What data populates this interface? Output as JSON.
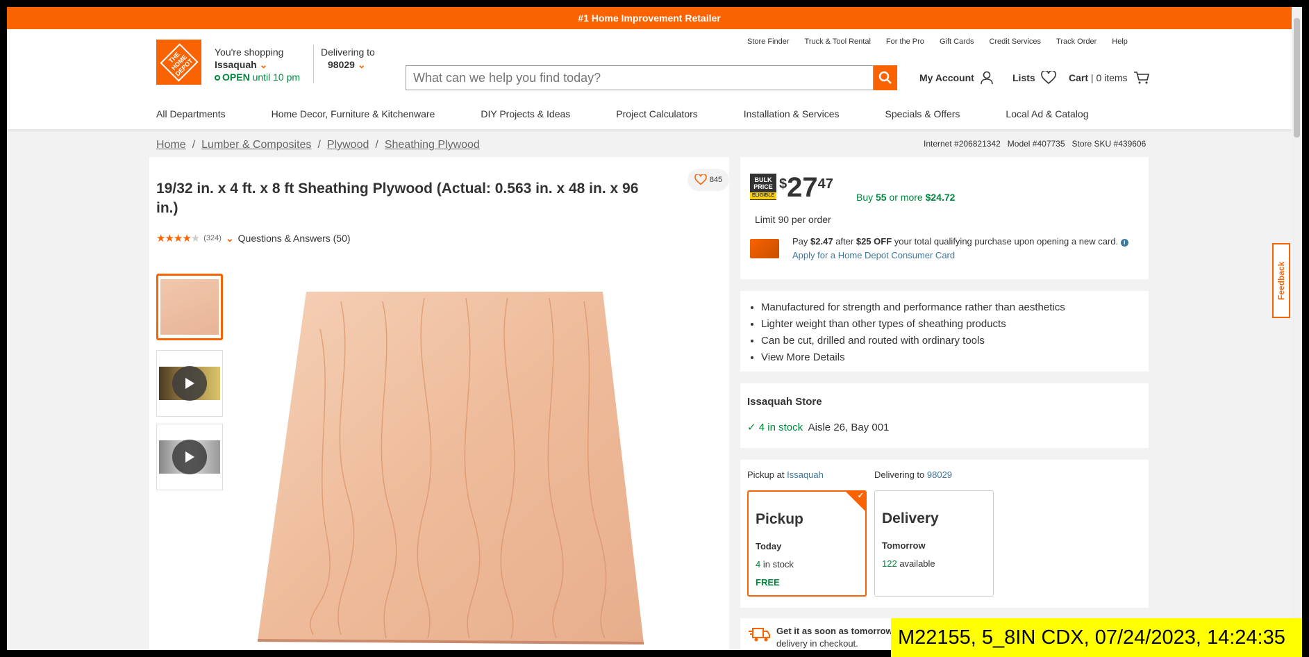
{
  "promo": "#1 Home Improvement Retailer",
  "logo": "THE HOME DEPOT",
  "store": {
    "shopping_label": "You're shopping",
    "name": "Issaquah",
    "open": "OPEN",
    "hours": "until 10 pm"
  },
  "delivery": {
    "label": "Delivering to",
    "zip": "98029"
  },
  "search": {
    "placeholder": "What can we help you find today?"
  },
  "toplinks": [
    "Store Finder",
    "Truck & Tool Rental",
    "For the Pro",
    "Gift Cards",
    "Credit Services",
    "Track Order",
    "Help"
  ],
  "account": {
    "my_account": "My Account",
    "lists": "Lists",
    "cart": "Cart",
    "cart_items": "0 items"
  },
  "nav": [
    "All Departments",
    "Home Decor, Furniture & Kitchenware",
    "DIY Projects & Ideas",
    "Project Calculators",
    "Installation & Services",
    "Specials & Offers",
    "Local Ad & Catalog"
  ],
  "breadcrumb": [
    "Home",
    "Lumber & Composites",
    "Plywood",
    "Sheathing Plywood"
  ],
  "ids": {
    "internet": "Internet #206821342",
    "model": "Model #407735",
    "sku": "Store SKU #439606"
  },
  "product": {
    "title": "19/32 in. x 4 ft. x 8 ft Sheathing Plywood (Actual: 0.563 in. x 48 in. x 96 in.)",
    "favorites": "845",
    "rating": 4,
    "reviews": "(324)",
    "qa": "Questions & Answers (50)"
  },
  "pricing": {
    "bulk": "BULK PRICE",
    "bulk_sub": "ELIGIBLE",
    "dollar": "$",
    "whole": "27",
    "cents": "47",
    "buy_prefix": "Buy",
    "buy_qty": "55",
    "buy_mid": "or more",
    "buy_price": "$24.72",
    "limit": "Limit 90 per order",
    "pay_text_1": "Pay",
    "pay_amt": "$2.47",
    "pay_text_2": "after",
    "pay_off": "$25 OFF",
    "pay_text_3": "your total qualifying purchase upon opening a new card.",
    "apply": "Apply for a Home Depot Consumer Card"
  },
  "bullets": [
    "Manufactured for strength and performance rather than aesthetics",
    "Lighter weight than other types of sheathing products",
    "Can be cut, drilled and routed with ordinary tools"
  ],
  "details_link": "View More Details",
  "store_stock": {
    "name": "Issaquah Store",
    "stock": "4 in stock",
    "location": "Aisle 26, Bay 001"
  },
  "fulfillment": {
    "pickup_label": "Pickup at",
    "pickup_store": "Issaquah",
    "deliv_label": "Delivering to",
    "deliv_zip": "98029",
    "pickup": {
      "title": "Pickup",
      "when": "Today",
      "qty": "4",
      "qty_text": "in stock",
      "price": "FREE"
    },
    "delivery": {
      "title": "Delivery",
      "when": "Tomorrow",
      "qty": "122",
      "qty_text": "available"
    }
  },
  "ship": {
    "line1": "Get it as soon as tomorrow",
    "line2": "delivery in checkout."
  },
  "feedback": "Feedback",
  "stamp": "M22155, 5_8IN CDX, 07/24/2023, 14:24:35",
  "colors": {
    "brand": "#f96302",
    "green": "#00873c",
    "link": "#3e7697"
  }
}
